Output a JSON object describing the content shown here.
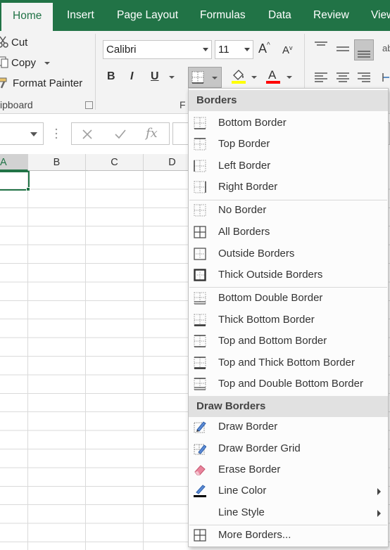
{
  "ribbon": {
    "tabs": [
      "Home",
      "Insert",
      "Page Layout",
      "Formulas",
      "Data",
      "Review",
      "View"
    ],
    "clipboard": {
      "cut": "Cut",
      "copy": "Copy",
      "format_painter": "Format Painter",
      "group_label": "ipboard"
    },
    "font": {
      "name": "Calibri",
      "size": "11",
      "bold": "B",
      "italic": "I",
      "underline": "U",
      "group_label_partial": "F"
    }
  },
  "formula_bar": {
    "fx": "fx"
  },
  "columns": [
    "A",
    "B",
    "C",
    "D"
  ],
  "borders_menu": {
    "header1": "Borders",
    "items1": [
      "Bottom Border",
      "Top Border",
      "Left Border",
      "Right Border",
      "No Border",
      "All Borders",
      "Outside Borders",
      "Thick Outside Borders",
      "Bottom Double Border",
      "Thick Bottom Border",
      "Top and Bottom Border",
      "Top and Thick Bottom Border",
      "Top and Double Bottom Border"
    ],
    "header2": "Draw Borders",
    "items2": [
      "Draw Border",
      "Draw Border Grid",
      "Erase Border",
      "Line Color",
      "Line Style",
      "More Borders..."
    ]
  },
  "colors": {
    "accent": "#217346",
    "font_color_bar": "#ff0000",
    "fill_color_bar": "#ffff00"
  }
}
